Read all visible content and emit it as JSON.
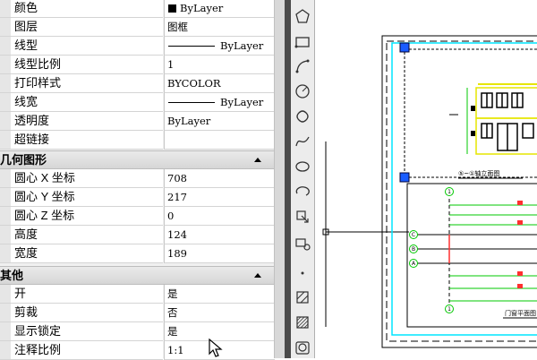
{
  "general": [
    {
      "label": "颜色",
      "value": "ByLayer",
      "kind": "color",
      "color": "#000000"
    },
    {
      "label": "图层",
      "value": "图框",
      "kind": "text"
    },
    {
      "label": "线型",
      "value": "ByLayer",
      "kind": "linetype"
    },
    {
      "label": "线型比例",
      "value": "1",
      "kind": "text"
    },
    {
      "label": "打印样式",
      "value": "BYCOLOR",
      "kind": "text"
    },
    {
      "label": "线宽",
      "value": "ByLayer",
      "kind": "linetype"
    },
    {
      "label": "透明度",
      "value": "ByLayer",
      "kind": "text"
    },
    {
      "label": "超链接",
      "value": "",
      "kind": "text"
    }
  ],
  "geometry": {
    "title": "几何图形",
    "rows": [
      {
        "label": "圆心 X 坐标",
        "value": "708"
      },
      {
        "label": "圆心 Y 坐标",
        "value": "217"
      },
      {
        "label": "圆心 Z 坐标",
        "value": "0"
      },
      {
        "label": "高度",
        "value": "124"
      },
      {
        "label": "宽度",
        "value": "189"
      }
    ]
  },
  "misc": {
    "title": "其他",
    "rows": [
      {
        "label": "开",
        "value": "是"
      },
      {
        "label": "剪裁",
        "value": "否"
      },
      {
        "label": "显示锁定",
        "value": "是"
      },
      {
        "label": "注释比例",
        "value": "1:1"
      }
    ]
  },
  "toolbar": {
    "tools": [
      "polygon-icon",
      "rectangle-icon",
      "arc-icon",
      "circle-icon",
      "revision-cloud-icon",
      "spline-icon",
      "ellipse-icon",
      "ellipse-arc-icon",
      "insert-block-icon",
      "make-block-icon",
      "point-icon",
      "hatch-icon",
      "gradient-icon",
      "region-icon"
    ]
  },
  "drawing": {
    "elevation_title": "⑤~①轴立面图",
    "plan_title": "门窗平面图",
    "grid_labels": [
      "1",
      "C",
      "B",
      "A",
      "1"
    ],
    "accent_colors": {
      "frame": "#00e5ff",
      "facade": "#e6e600",
      "grid": "#00c800",
      "grip": "#1a5cff",
      "cut": "#ff3030"
    }
  }
}
